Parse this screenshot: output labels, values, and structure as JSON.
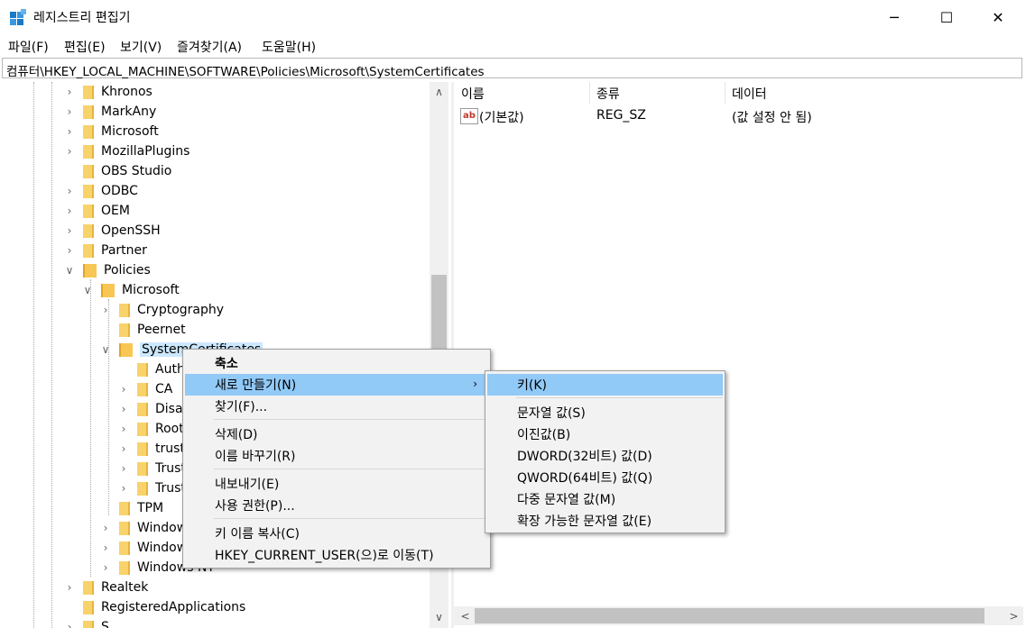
{
  "window": {
    "title": "레지스트리 편집기",
    "minimize_glyph": "─",
    "maximize_glyph": "☐",
    "close_glyph": "✕"
  },
  "menubar": [
    "파일(F)",
    "편집(E)",
    "보기(V)",
    "즐겨찾기(A)",
    "도움말(H)"
  ],
  "address": "컴퓨터\\HKEY_LOCAL_MACHINE\\SOFTWARE\\Policies\\Microsoft\\SystemCertificates",
  "tree": [
    {
      "label": "Khronos",
      "level": 0,
      "expander": ">"
    },
    {
      "label": "MarkAny",
      "level": 0,
      "expander": ">"
    },
    {
      "label": "Microsoft",
      "level": 0,
      "expander": ">"
    },
    {
      "label": "MozillaPlugins",
      "level": 0,
      "expander": ">"
    },
    {
      "label": "OBS Studio",
      "level": 0,
      "expander": ""
    },
    {
      "label": "ODBC",
      "level": 0,
      "expander": ">"
    },
    {
      "label": "OEM",
      "level": 0,
      "expander": ">"
    },
    {
      "label": "OpenSSH",
      "level": 0,
      "expander": ">"
    },
    {
      "label": "Partner",
      "level": 0,
      "expander": ">"
    },
    {
      "label": "Policies",
      "level": 0,
      "expander": "v"
    },
    {
      "label": "Microsoft",
      "level": 1,
      "expander": "v"
    },
    {
      "label": "Cryptography",
      "level": 2,
      "expander": ">"
    },
    {
      "label": "Peernet",
      "level": 2,
      "expander": ""
    },
    {
      "label": "SystemCertificates",
      "level": 2,
      "expander": "v"
    },
    {
      "label": "Auth",
      "level": 3,
      "expander": ""
    },
    {
      "label": "CA",
      "level": 3,
      "expander": ">"
    },
    {
      "label": "Disa",
      "level": 3,
      "expander": ">"
    },
    {
      "label": "Root",
      "level": 3,
      "expander": ">"
    },
    {
      "label": "trust",
      "level": 3,
      "expander": ">"
    },
    {
      "label": "Trust",
      "level": 3,
      "expander": ">"
    },
    {
      "label": "Trust",
      "level": 3,
      "expander": ">"
    },
    {
      "label": "TPM",
      "level": 2,
      "expander": ""
    },
    {
      "label": "Window",
      "level": 2,
      "expander": ">"
    },
    {
      "label": "Window",
      "level": 2,
      "expander": ">"
    },
    {
      "label": "Windows NT",
      "level": 2,
      "expander": ">"
    },
    {
      "label": "Realtek",
      "level": 0,
      "expander": ">"
    },
    {
      "label": "RegisteredApplications",
      "level": 0,
      "expander": ""
    },
    {
      "label": "S",
      "level": 0,
      "expander": ">"
    }
  ],
  "columns": {
    "name": "이름",
    "type": "종류",
    "data": "데이터"
  },
  "values": [
    {
      "icon_text": "ab",
      "name": "(기본값)",
      "type": "REG_SZ",
      "data": "(값 설정 안 됨)"
    }
  ],
  "scroll": {
    "up": "∧",
    "down": "∨",
    "left": "<",
    "right": ">"
  },
  "context_menu": [
    {
      "label": "축소",
      "bold": true
    },
    {
      "label": "새로 만들기(N)",
      "arrow": "›",
      "highlighted": true
    },
    {
      "label": "찾기(F)..."
    },
    {
      "separator": true
    },
    {
      "label": "삭제(D)"
    },
    {
      "label": "이름 바꾸기(R)"
    },
    {
      "separator": true
    },
    {
      "label": "내보내기(E)"
    },
    {
      "label": "사용 권한(P)..."
    },
    {
      "separator": true
    },
    {
      "label": "키 이름 복사(C)"
    },
    {
      "label": "HKEY_CURRENT_USER(으)로 이동(T)"
    }
  ],
  "submenu": [
    {
      "label": "키(K)",
      "highlighted": true
    },
    {
      "separator": true
    },
    {
      "label": "문자열 값(S)"
    },
    {
      "label": "이진값(B)"
    },
    {
      "label": "DWORD(32비트) 값(D)"
    },
    {
      "label": "QWORD(64비트) 값(Q)"
    },
    {
      "label": "다중 문자열 값(M)"
    },
    {
      "label": "확장 가능한 문자열 값(E)"
    }
  ],
  "colors": {
    "highlight": "#91c9f7",
    "menu_bg": "#f2f2f2",
    "folder": "#f8d26a"
  }
}
